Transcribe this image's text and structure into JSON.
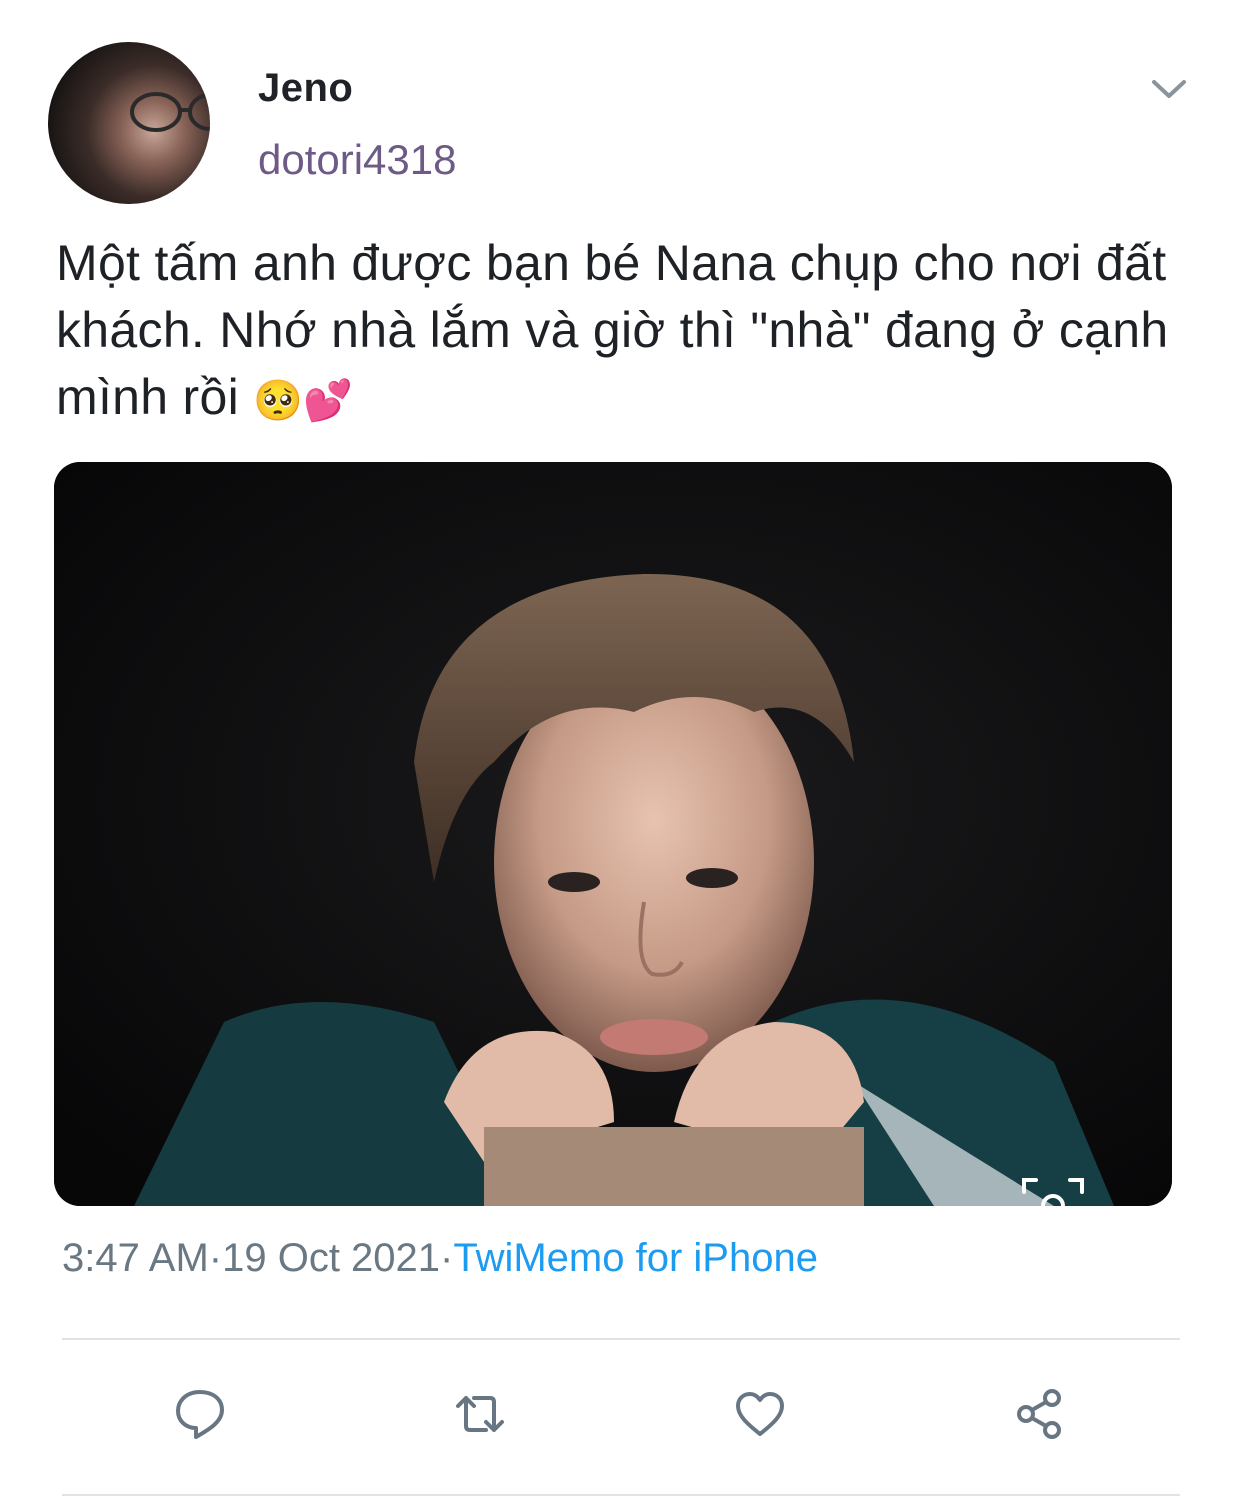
{
  "user": {
    "display_name": "Jeno",
    "handle": "dotori4318",
    "avatar_icon": "profile-photo"
  },
  "tweet": {
    "text": "Một tấm anh được bạn bé Nana chụp cho nơi đất khách. Nhớ nhà lắm và giờ thì \"nhà\" đang ở cạnh mình rồi",
    "emoji": "🥺💕",
    "media_alt": "photo"
  },
  "meta": {
    "time": "3:47 AM",
    "separator": "·",
    "date": "19 Oct 2021",
    "source": "TwiMemo for iPhone"
  },
  "actions": {
    "reply_icon": "speech-bubble",
    "retweet_icon": "retweet-arrows",
    "like_icon": "heart",
    "share_icon": "share-nodes"
  },
  "colors": {
    "accent": "#1d9bf0",
    "handle": "#6e5a86",
    "meta": "#697882",
    "icon": "#687684",
    "divider": "#dfe3e6"
  }
}
